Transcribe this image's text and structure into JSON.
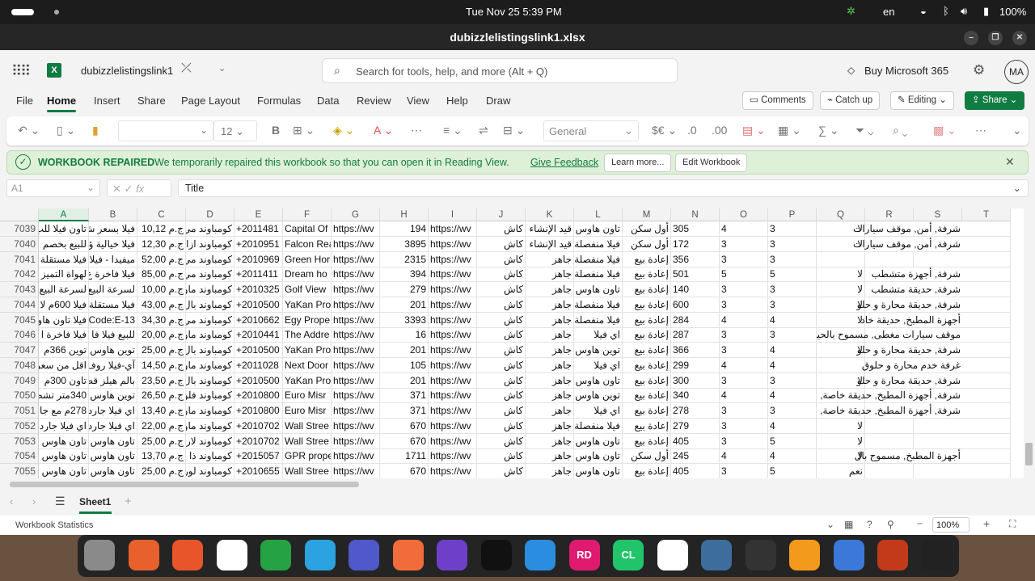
{
  "system_bar": {
    "datetime": "Tue Nov 25   5:39 PM",
    "language": "en",
    "battery": "100%"
  },
  "window": {
    "title": "dubizzlelistingslink1.xlsx"
  },
  "header": {
    "file_name": "dubizzlelistingslink1",
    "search_placeholder": "Search for tools, help, and more (Alt + Q)",
    "buy_label": "Buy Microsoft 365",
    "avatar": "MA"
  },
  "menu": {
    "tabs": [
      "File",
      "Home",
      "Insert",
      "Share",
      "Page Layout",
      "Formulas",
      "Data",
      "Review",
      "View",
      "Help",
      "Draw"
    ],
    "active": "Home",
    "comments": "Comments",
    "catch_up": "Catch up",
    "editing": "Editing",
    "share": "Share"
  },
  "ribbon": {
    "font_size": "12",
    "number_format": "General"
  },
  "banner": {
    "title": "WORKBOOK REPAIRED",
    "message": "We temporarily repaired this workbook so that you can open it in Reading View.",
    "feedback": "Give Feedback",
    "learn_more": "Learn more...",
    "edit_workbook": "Edit Workbook"
  },
  "formula_bar": {
    "name_box": "A1",
    "formula": "Title"
  },
  "grid": {
    "columns": [
      "A",
      "B",
      "C",
      "D",
      "E",
      "F",
      "G",
      "H",
      "I",
      "J",
      "K",
      "L",
      "M",
      "N",
      "O",
      "P",
      "Q",
      "R",
      "S",
      "T"
    ],
    "rows": [
      {
        "n": "7039",
        "c": [
          "تاون فيلا للب",
          "فيلا بسعر ش",
          "ج.م 10,12",
          "كومباوند مي",
          "+2011481",
          "Capital Of",
          "https://wv",
          "194",
          "https://wv",
          "كاش",
          "قيد الإنشاء",
          "تاون هاوس",
          "أول سكن",
          "305",
          "4",
          "3",
          "لا",
          "",
          "شرفة, أمن, موقف سيارات",
          ""
        ]
      },
      {
        "n": "7040",
        "c": [
          "للبيع بخصم",
          "فيلا خيالية ؤ",
          "ج.م 12,30",
          "كومباوند ازا",
          "+2010951",
          "Falcon Rea",
          "https://wv",
          "3895",
          "https://wv",
          "كاش",
          "قيد الإنشاء",
          "فيلا منفصلة",
          "أول سكن",
          "172",
          "3",
          "3",
          "لا",
          "",
          "شرفة, أمن, موقف سيارات",
          ""
        ]
      },
      {
        "n": "7041",
        "c": [
          "فيلا مستقلة",
          "ميفيدا - فيلا",
          "ج.م 52,00",
          "كومباوند مي",
          "+2010969",
          "Green Hor",
          "https://wv",
          "2315",
          "https://wv",
          "كاش",
          "جاهز",
          "فيلا منفصلة",
          "إعادة بيع",
          "356",
          "3",
          "3",
          "",
          "",
          "",
          ""
        ]
      },
      {
        "n": "7042",
        "c": [
          "لهواة التميز ف",
          "فيلا فاخرة ع",
          "ج.م 85,00",
          "كومباوند مي",
          "+2011411",
          "Dream ho",
          "https://wv",
          "394",
          "https://wv",
          "كاش",
          "جاهز",
          "فيلا منفصلة",
          "إعادة بيع",
          "501",
          "5",
          "5",
          "لا",
          "",
          "شرفة, أجهزة متشطب",
          ""
        ]
      },
      {
        "n": "7043",
        "c": [
          "لسرعة البيع",
          "لسرعة البيع",
          "ج.م 10,00",
          "كومباوند ماو",
          "+2010325",
          "Golf View",
          "https://wv",
          "279",
          "https://wv",
          "كاش",
          "جاهز",
          "تاون هاوس",
          "إعادة بيع",
          "140",
          "3",
          "3",
          "لا",
          "",
          "شرفة, حديقة متشطب",
          ""
        ]
      },
      {
        "n": "7044",
        "c": [
          "فيلا 600م لا",
          "فيلا مستقلة",
          "ج.م 43,00",
          "كومباوند بال",
          "+2010500",
          "YaKan Pro",
          "https://wv",
          "201",
          "https://wv",
          "كاش",
          "جاهز",
          "فيلا منفصلة",
          "إعادة بيع",
          "600",
          "3",
          "3",
          "لا",
          "",
          "شرفة, حديقة محارة و حلو",
          ""
        ]
      },
      {
        "n": "7045",
        "c": [
          "فيلا تاون هاو",
          "Code:E-13",
          "ج.م 34,30",
          "كومباوند مي",
          "+2010662",
          "Egy Prope",
          "https://wv",
          "3393",
          "https://wv",
          "كاش",
          "جاهز",
          "فيلا منفصلة",
          "إعادة بيع",
          "284",
          "4",
          "4",
          "لا",
          "",
          "أجهزة المطبخ, حديقة خاد",
          ""
        ]
      },
      {
        "n": "7046",
        "c": [
          "فيلا فاخرة ا",
          "للبيع فيلا فا",
          "ج.م 20,00",
          "كومباوند ماو",
          "+2010441",
          "The Addre",
          "https://wv",
          "16",
          "https://wv",
          "كاش",
          "جاهز",
          "اي فيلا",
          "إعادة بيع",
          "287",
          "3",
          "3",
          "",
          "",
          "موقف سيارات مغطى, مسموح بالحيوانات",
          ""
        ]
      },
      {
        "n": "7047",
        "c": [
          "توين 366م",
          "توين هاوس",
          "ج.م 25,00",
          "كومباوند بال",
          "+2010500",
          "YaKan Pro",
          "https://wv",
          "201",
          "https://wv",
          "كاش",
          "جاهز",
          "توين هاوس",
          "إعادة بيع",
          "366",
          "3",
          "4",
          "لا",
          "",
          "شرفة, حديقة محارة و حلو",
          ""
        ]
      },
      {
        "n": "7048",
        "c": [
          "اقل من سعر",
          "آي-فيلا روف",
          "ج.م 14,50",
          "كومباوند ماو",
          "+2011028",
          "Next Door",
          "https://wv",
          "105",
          "https://wv",
          "كاش",
          "جاهز",
          "اي فيلا",
          "إعادة بيع",
          "299",
          "4",
          "4",
          "",
          "",
          "غرفة خدم   محارة و حلوق",
          ""
        ]
      },
      {
        "n": "7049",
        "c": [
          "تاون 300م",
          "بالم هيلز قط",
          "ج.م 23,50",
          "كومباوند بال",
          "+2010500",
          "YaKan Pro",
          "https://wv",
          "201",
          "https://wv",
          "كاش",
          "جاهز",
          "تاون هاوس",
          "إعادة بيع",
          "300",
          "3",
          "3",
          "لا",
          "",
          "شرفة, حديقة محارة و حلو",
          ""
        ]
      },
      {
        "n": "7050",
        "c": [
          "340متر تشط",
          "توين هاوس",
          "ج.م 26,50",
          "كومباوند فلو",
          "+2010800",
          "Euro Misr",
          "https://wv",
          "371",
          "https://wv",
          "كاش",
          "جاهز",
          "توين هاوس",
          "إعادة بيع",
          "340",
          "4",
          "4",
          "",
          "",
          "شرفة, أجهزة المطبخ, حديقة خاصة, أمن",
          ""
        ]
      },
      {
        "n": "7051",
        "c": [
          "278م مع جا",
          "اي فيلا جارد",
          "ج.م 13,40",
          "كومباوند ماو",
          "+2010800",
          "Euro Misr",
          "https://wv",
          "371",
          "https://wv",
          "كاش",
          "جاهز",
          "اي فيلا",
          "إعادة بيع",
          "278",
          "3",
          "3",
          "",
          "",
          "شرفة, أجهزة المطبخ, حديقة خاصة, أمن",
          ""
        ]
      },
      {
        "n": "7052",
        "c": [
          "اي فيلا جارد",
          "اي فيلا جارد",
          "ج.م 22,00",
          "كومباوند ماو",
          "+2010702",
          "Wall Stree",
          "https://wv",
          "670",
          "https://wv",
          "كاش",
          "جاهز",
          "فيلا منفصلة",
          "إعادة بيع",
          "279",
          "3",
          "4",
          "لا",
          "",
          "",
          ""
        ]
      },
      {
        "n": "7053",
        "c": [
          "تاون هاوس",
          "تاون هاوس",
          "ج.م 25,00",
          "كومباوند لار",
          "+2010702",
          "Wall Stree",
          "https://wv",
          "670",
          "https://wv",
          "كاش",
          "جاهز",
          "تاون هاوس",
          "إعادة بيع",
          "405",
          "3",
          "5",
          "لا",
          "",
          "",
          ""
        ]
      },
      {
        "n": "7054",
        "c": [
          "تاون هاوس",
          "تاون هاوس",
          "ج.م 13,70",
          "كومباوند ذا",
          "+2015057",
          "GPR prope",
          "https://wv",
          "1711",
          "https://wv",
          "كاش",
          "جاهز",
          "تاون هاوس",
          "أول سكن",
          "245",
          "4",
          "4",
          "لا",
          "",
          "أجهزة المطبخ, مسموح بال",
          ""
        ]
      },
      {
        "n": "7055",
        "c": [
          "تاون هاوس",
          "تاون هاوس",
          "ج.م 25,00",
          "كومباوند لور",
          "+2010655",
          "Wall Stree",
          "https://wv",
          "670",
          "https://wv",
          "كاش",
          "جاهز",
          "تاون هاوس",
          "إعادة بيع",
          "405",
          "3",
          "5",
          "نعم",
          "",
          "",
          ""
        ]
      }
    ]
  },
  "sheets": {
    "tabs": [
      "Sheet1"
    ],
    "active": "Sheet1"
  },
  "status_bar": {
    "left": "Workbook Statistics",
    "zoom": "100%"
  },
  "dock": {
    "apps": [
      "Files",
      "Firefox",
      "Brave",
      "Slack",
      "WhatsApp",
      "Telegram",
      "Teams",
      "Postman",
      "GitHub Desktop",
      "Inkscape",
      "VS Code",
      "Rider",
      "CLion",
      "DBeaver",
      "pgAdmin",
      "Terminal",
      "Draw.io",
      "Text Editor",
      "Office",
      "Show Apps"
    ],
    "labels": {
      "rider": "RD",
      "clion": "CL"
    }
  },
  "colors": {
    "excel_green": "#107c41",
    "banner_bg": "#dff0d8",
    "accent": "#217346"
  }
}
